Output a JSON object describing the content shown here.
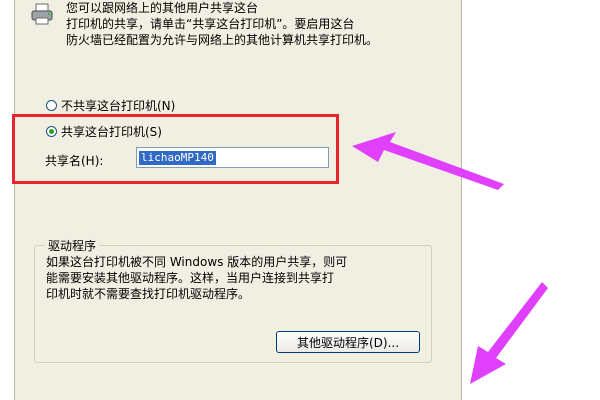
{
  "dialog": {
    "intro_text": "您可以跟网络上的其他用户共享这台\n打印机的共享，请单击“共享这台打印机”。要启用这台\n防火墙已经配置为允许与网络上的其他计算机共享打印机。",
    "windows_word": "Windows",
    "sharing": {
      "no_share_label": "不共享这台打印机(N)",
      "share_label": "共享这台打印机(S)",
      "selected": "share",
      "share_name_label": "共享名(H):",
      "share_name_value": "lichaoMP140"
    },
    "drivers": {
      "group_title": "驱动程序",
      "text": "如果这台打印机被不同 Windows 版本的用户共享，则可\n能需要安装其他驱动程序。这样，当用户连接到共享打\n印机时就不需要查找打印机驱动程序。",
      "button_label": "其他驱动程序(D)..."
    }
  },
  "annotations": {
    "highlight_color": "#e8242c",
    "arrow_color": "#e040fb"
  },
  "icons": {
    "printer": "printer-icon",
    "arrow": "pointer-arrow-icon"
  }
}
